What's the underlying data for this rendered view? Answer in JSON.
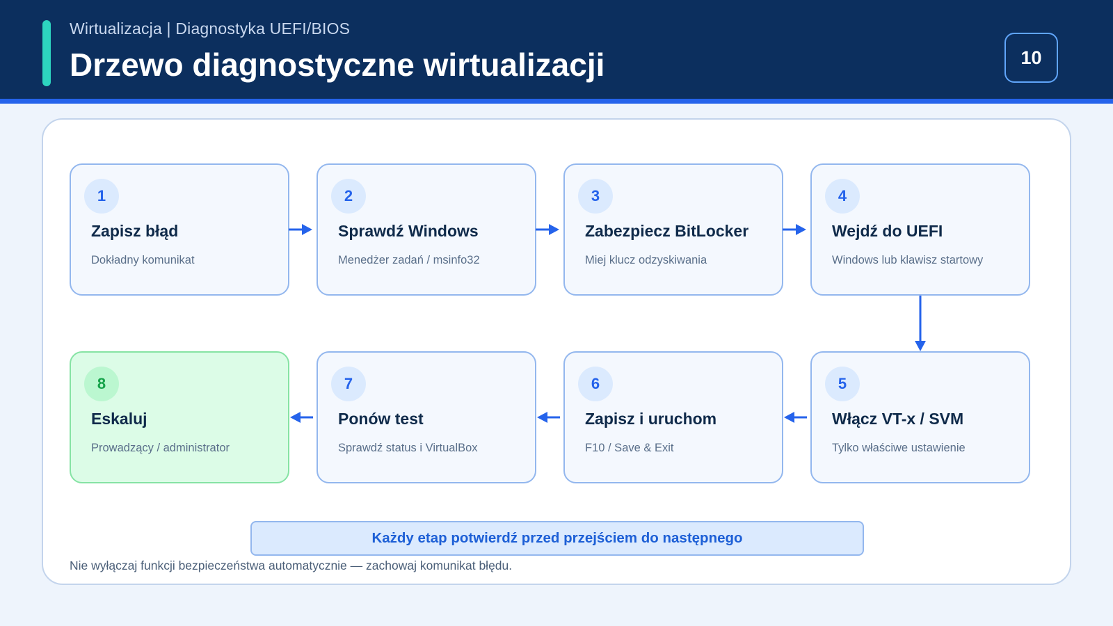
{
  "header": {
    "subtitle": "Wirtualizacja | Diagnostyka UEFI/BIOS",
    "title": "Drzewo diagnostyczne wirtualizacji",
    "page_number": "10"
  },
  "steps": [
    {
      "num": "1",
      "title": "Zapisz błąd",
      "desc": "Dokładny komunikat"
    },
    {
      "num": "2",
      "title": "Sprawdź Windows",
      "desc": "Menedżer zadań / msinfo32"
    },
    {
      "num": "3",
      "title": "Zabezpiecz BitLocker",
      "desc": "Miej klucz odzyskiwania"
    },
    {
      "num": "4",
      "title": "Wejdź do UEFI",
      "desc": "Windows lub klawisz startowy"
    },
    {
      "num": "5",
      "title": "Włącz VT-x / SVM",
      "desc": "Tylko właściwe ustawienie"
    },
    {
      "num": "6",
      "title": "Zapisz i uruchom",
      "desc": "F10 / Save & Exit"
    },
    {
      "num": "7",
      "title": "Ponów test",
      "desc": "Sprawdź status i VirtualBox"
    },
    {
      "num": "8",
      "title": "Eskaluj",
      "desc": "Prowadzący / administrator"
    }
  ],
  "banner": "Każdy etap potwierdź przed przejściem do następnego",
  "note": "Nie wyłączaj funkcji bezpieczeństwa automatycznie — zachowaj komunikat błędu.",
  "colors": {
    "header_bg": "#0c2f5e",
    "accent": "#2dd4bf",
    "primary": "#2563eb",
    "final_step": "#dcfce7"
  }
}
